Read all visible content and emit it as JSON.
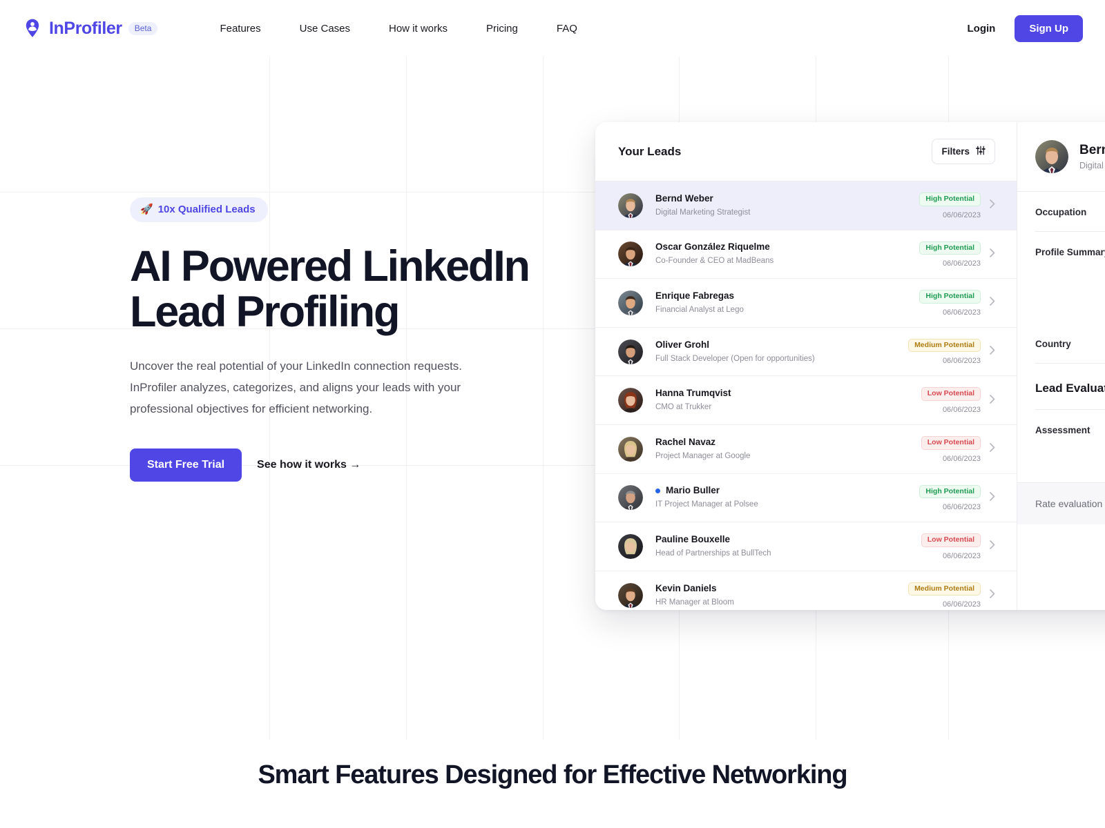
{
  "brand": {
    "name": "InProfiler",
    "badge": "Beta",
    "logo_icon": "location-pin-person-icon",
    "accent_color": "#4f46e5"
  },
  "nav": {
    "items": [
      {
        "label": "Features"
      },
      {
        "label": "Use Cases"
      },
      {
        "label": "How it works"
      },
      {
        "label": "Pricing"
      },
      {
        "label": "FAQ"
      }
    ],
    "login_label": "Login",
    "signup_label": "Sign Up"
  },
  "hero": {
    "badge_emoji": "🚀",
    "badge_label": "10x Qualified Leads",
    "title_line1": "AI Powered LinkedIn",
    "title_line2": "Lead Profiling",
    "subtitle": "Uncover the real potential of your LinkedIn connection requests. InProfiler analyzes, categorizes, and aligns your leads with your professional objectives for efficient networking.",
    "primary_cta": "Start Free Trial",
    "secondary_cta": "See how it works →"
  },
  "app": {
    "leads_title": "Your Leads",
    "filters_label": "Filters",
    "filters_icon": "sliders-icon",
    "chevron_icon": "chevron-right-icon",
    "leads": [
      {
        "name": "Bernd Weber",
        "role": "Digital Marketing Strategist",
        "potential": "High Potential",
        "level": "high",
        "date": "06/06/2023",
        "selected": true,
        "unread": false,
        "avatar": "male-1"
      },
      {
        "name": "Oscar González Riquelme",
        "role": "Co-Founder & CEO at MadBeans",
        "potential": "High Potential",
        "level": "high",
        "date": "06/06/2023",
        "selected": false,
        "unread": false,
        "avatar": "male-2"
      },
      {
        "name": "Enrique Fabregas",
        "role": "Financial Analyst at Lego",
        "potential": "High Potential",
        "level": "high",
        "date": "06/06/2023",
        "selected": false,
        "unread": false,
        "avatar": "male-3"
      },
      {
        "name": "Oliver Grohl",
        "role": "Full Stack Developer (Open for opportunities)",
        "potential": "Medium Potential",
        "level": "medium",
        "date": "06/06/2023",
        "selected": false,
        "unread": false,
        "avatar": "male-4"
      },
      {
        "name": "Hanna Trumqvist",
        "role": "CMO at Trukker",
        "potential": "Low Potential",
        "level": "low",
        "date": "06/06/2023",
        "selected": false,
        "unread": false,
        "avatar": "female-1"
      },
      {
        "name": "Rachel Navaz",
        "role": "Project Manager at Google",
        "potential": "Low Potential",
        "level": "low",
        "date": "06/06/2023",
        "selected": false,
        "unread": false,
        "avatar": "female-2"
      },
      {
        "name": "Mario Buller",
        "role": "IT Project Manager at Polsee",
        "potential": "High Potential",
        "level": "high",
        "date": "06/06/2023",
        "selected": false,
        "unread": true,
        "avatar": "male-5"
      },
      {
        "name": "Pauline Bouxelle",
        "role": "Head of Partnerships at BullTech",
        "potential": "Low Potential",
        "level": "low",
        "date": "06/06/2023",
        "selected": false,
        "unread": false,
        "avatar": "female-3"
      },
      {
        "name": "Kevin Daniels",
        "role": "HR Manager at Bloom",
        "potential": "Medium Potential",
        "level": "medium",
        "date": "06/06/2023",
        "selected": false,
        "unread": false,
        "avatar": "male-6"
      }
    ],
    "detail": {
      "name": "Bernd Weber",
      "role": "Digital Marketing Strategist",
      "occupation_label": "Occupation",
      "profile_summary_label": "Profile Summary",
      "country_label": "Country",
      "lead_evaluation_title": "Lead Evaluation",
      "assessment_label": "Assessment",
      "rate_label": "Rate evaluation"
    }
  },
  "features_section": {
    "heading": "Smart Features Designed for Effective Networking"
  }
}
